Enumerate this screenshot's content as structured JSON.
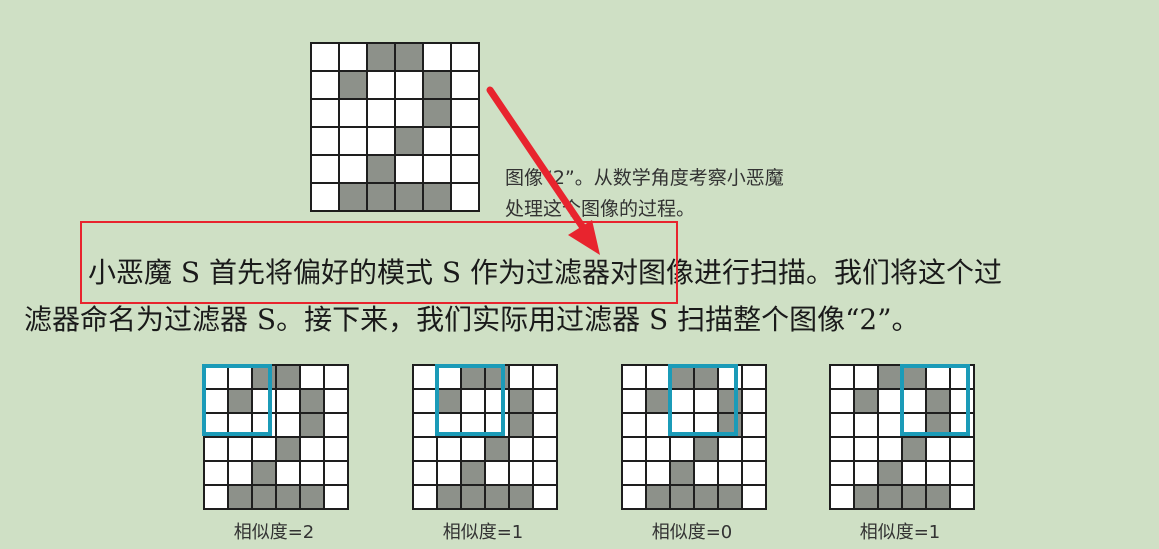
{
  "top_image": {
    "caption_line1": "图像“2”。从数学角度考察小恶魔",
    "caption_line2": "处理这个图像的过程。",
    "pattern": [
      [
        0,
        0,
        1,
        1,
        0,
        0
      ],
      [
        0,
        1,
        0,
        0,
        1,
        0
      ],
      [
        0,
        0,
        0,
        0,
        1,
        0
      ],
      [
        0,
        0,
        0,
        1,
        0,
        0
      ],
      [
        0,
        0,
        1,
        0,
        0,
        0
      ],
      [
        0,
        1,
        1,
        1,
        1,
        0
      ]
    ]
  },
  "paragraph": {
    "line1": "小恶魔 S 首先将偏好的模式 S 作为过滤器对图像进行扫描。我们将这个过",
    "line2": "滤器命名为过滤器 S。接下来，我们实际用过滤器 S 扫描整个图像“2”。"
  },
  "scans": [
    {
      "label": "相似度=2",
      "filter_col": 0
    },
    {
      "label": "相似度=1",
      "filter_col": 1
    },
    {
      "label": "相似度=0",
      "filter_col": 2
    },
    {
      "label": "相似度=1",
      "filter_col": 3
    }
  ],
  "colors": {
    "background": "#cfe0c5",
    "pixel_on": "#8d918a",
    "filter_box": "#1b9bb8",
    "annotation": "#e8242e"
  }
}
